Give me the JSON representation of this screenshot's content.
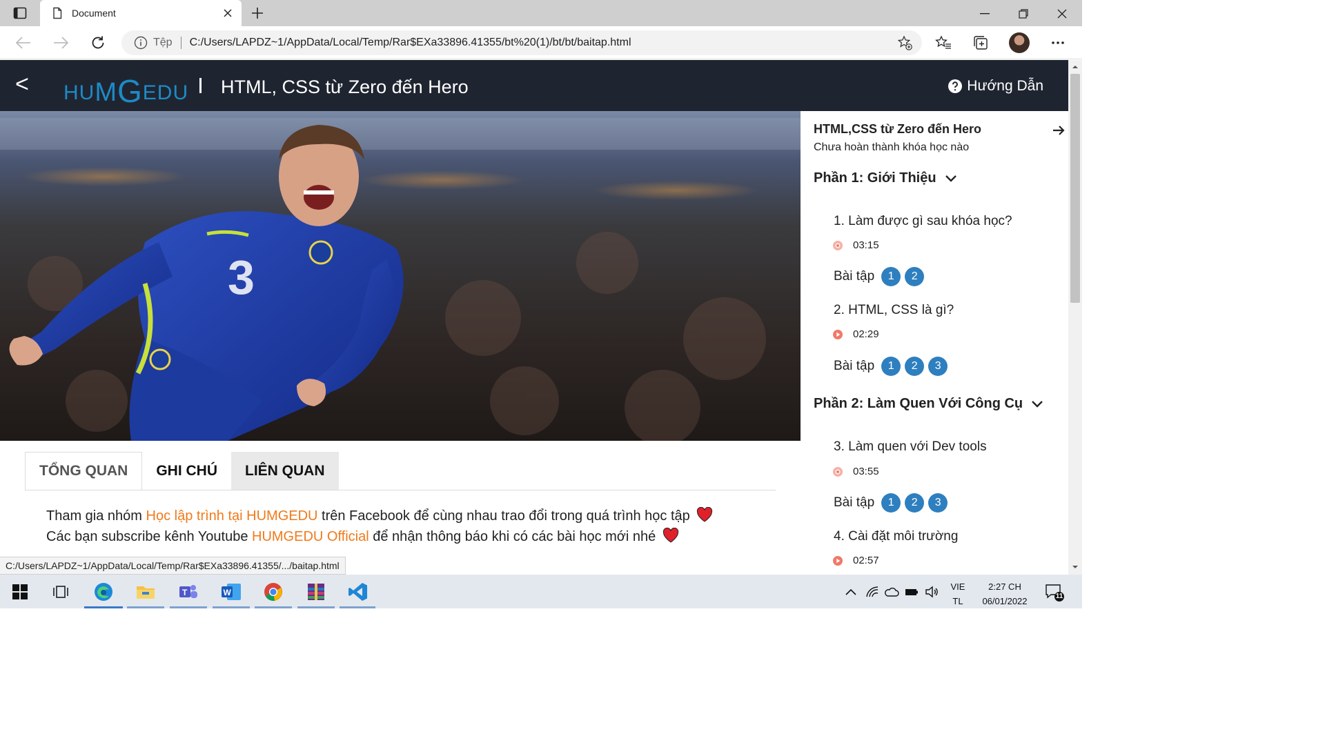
{
  "browser": {
    "tab_title": "Document",
    "scheme_label": "Tệp",
    "url": "C:/Users/LAPDZ~1/AppData/Local/Temp/Rar$EXa33896.41355/bt%20(1)/bt/bt/baitap.html",
    "status_url": "C:/Users/LAPDZ~1/AppData/Local/Temp/Rar$EXa33896.41355/.../baitap.html"
  },
  "header": {
    "back_label": "<",
    "logo": {
      "p1": "HU",
      "p2": "M",
      "p3": "G",
      "p4": "EDU"
    },
    "course_title": "HTML, CSS từ Zero đến Hero",
    "help_label": "Hướng Dẫn"
  },
  "tabs": [
    "TỔNG QUAN",
    "GHI CHÚ",
    "LIÊN QUAN"
  ],
  "notice": {
    "line1_a": "Tham gia nhóm ",
    "line1_link": "Học lập trình tại HUMGEDU",
    "line1_b": " trên Facebook để cùng nhau trao đổi trong quá trình học tập",
    "line2_a": "Các bạn subscribe kênh Youtube ",
    "line2_link": "HUMGEDU Official",
    "line2_b": " để nhận thông báo khi có các bài học mới nhé"
  },
  "sidebar": {
    "title": "HTML,CSS từ Zero đến Hero",
    "subtitle": "Chưa hoàn thành khóa học nào",
    "exercise_label": "Bài tập",
    "sections": [
      {
        "title": "Phần 1: Giới Thiệu",
        "lessons": [
          {
            "title": "1. Làm được gì sau khóa học?",
            "duration": "03:15",
            "exercises": [
              "1",
              "2"
            ]
          },
          {
            "title": "2. HTML, CSS là gì?",
            "duration": "02:29",
            "exercises": [
              "1",
              "2",
              "3"
            ]
          }
        ]
      },
      {
        "title": "Phần 2: Làm Quen Với Công Cụ",
        "lessons": [
          {
            "title": "3. Làm quen với Dev tools",
            "duration": "03:55",
            "exercises": [
              "1",
              "2",
              "3"
            ]
          },
          {
            "title": "4. Cài đặt môi trường",
            "duration": "02:57",
            "exercises": []
          }
        ]
      }
    ]
  },
  "taskbar": {
    "lang_top": "VIE",
    "lang_bottom": "TL",
    "time": "2:27 CH",
    "date": "06/01/2022",
    "notification_count": "11"
  },
  "colors": {
    "header_bg": "#1f2530",
    "logo_blue": "#1e8ac8",
    "link_orange": "#f07a1a",
    "badge_blue": "#2e7fbf",
    "play_orange": "#f07a6a"
  }
}
